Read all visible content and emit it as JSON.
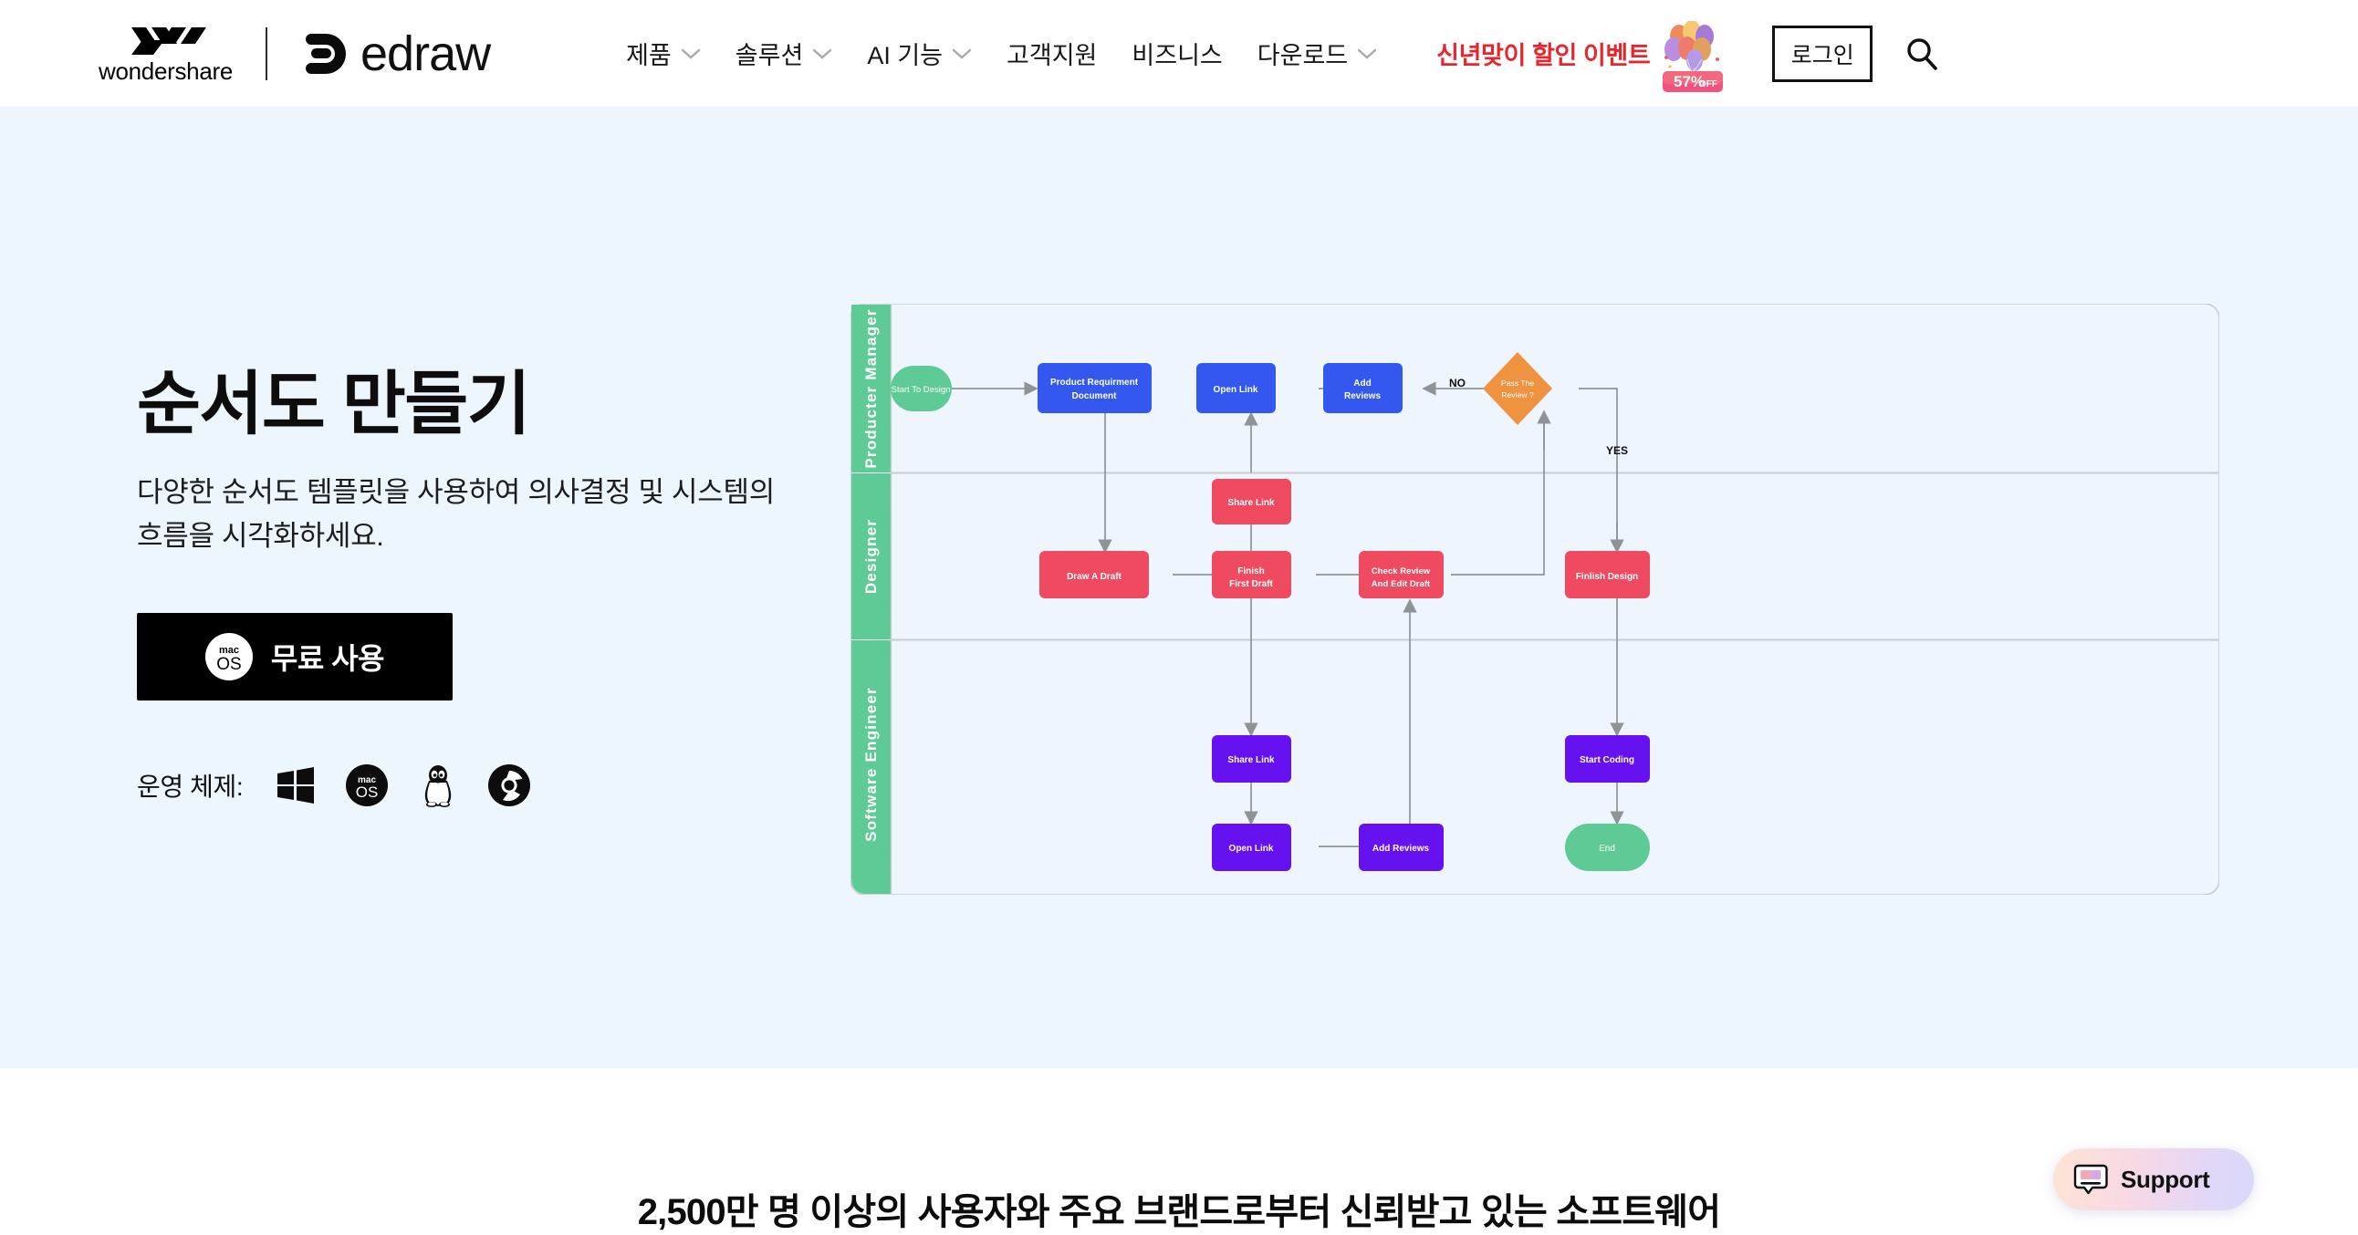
{
  "header": {
    "brand": {
      "wondershare_word": "wondershare",
      "wondershare_icon": "wondershare-w-logo",
      "divider_icon": "brand-divider",
      "edraw_word": "edraw",
      "edraw_icon": "edraw-logo-mark"
    },
    "nav": [
      {
        "label": "제품",
        "has_caret": true,
        "icon": "chevron-down-icon"
      },
      {
        "label": "솔루션",
        "has_caret": true,
        "icon": "chevron-down-icon"
      },
      {
        "label": "AI 기능",
        "has_caret": true,
        "icon": "chevron-down-icon"
      },
      {
        "label": "고객지원",
        "has_caret": false,
        "icon": ""
      },
      {
        "label": "비즈니스",
        "has_caret": false,
        "icon": ""
      },
      {
        "label": "다운로드",
        "has_caret": true,
        "icon": "chevron-down-icon"
      }
    ],
    "promo": {
      "text": "신년맞이 할인 이벤트",
      "badge_icon": "balloons-discount-icon",
      "badge_percent": "57%",
      "badge_off": "OFF",
      "color": "#e8252c"
    },
    "login_label": "로그인",
    "search_icon": "search-icon"
  },
  "hero": {
    "title": "순서도 만들기",
    "subtitle": "다양한 순서도 템플릿을 사용하여 의사결정 및 시스템의 흐름을 시각화하세요.",
    "cta": {
      "label": "무료 사용",
      "icon": "macos-icon"
    },
    "os": {
      "label": "운영 체제:",
      "items": [
        {
          "name": "windows-icon"
        },
        {
          "name": "macos-icon"
        },
        {
          "name": "linux-tux-icon"
        },
        {
          "name": "chrome-os-icon"
        }
      ]
    },
    "background_color": "#edf5fd"
  },
  "chart_data": {
    "type": "diagram",
    "title": "Flowchart swimlane diagram",
    "lane_color": "#5ecb96",
    "canvas_color": "#eef5fd",
    "lanes": [
      {
        "label": "Producter Manager"
      },
      {
        "label": "Designer"
      },
      {
        "label": "Software Engineer"
      }
    ],
    "nodes": [
      {
        "id": "start",
        "label": "Start To Design",
        "lane": 0,
        "shape": "stadium",
        "color": "#5ecb96"
      },
      {
        "id": "prd",
        "label": "Product Requirment Document",
        "lane": 0,
        "shape": "rect",
        "color": "#3357ef"
      },
      {
        "id": "open1",
        "label": "Open Link",
        "lane": 0,
        "shape": "rect",
        "color": "#3357ef"
      },
      {
        "id": "addrev1",
        "label": "Add Reviews",
        "lane": 0,
        "shape": "rect",
        "color": "#3357ef"
      },
      {
        "id": "pass",
        "label": "Pass The Review ?",
        "lane": 0,
        "shape": "diamond",
        "color": "#ef9340"
      },
      {
        "id": "share_d",
        "label": "Share Link",
        "lane": 1,
        "shape": "rect",
        "color": "#ef4a5f"
      },
      {
        "id": "draft",
        "label": "Draw A Draft",
        "lane": 1,
        "shape": "rect",
        "color": "#ef4a5f"
      },
      {
        "id": "finish1st",
        "label": "Finish First Draft",
        "lane": 1,
        "shape": "rect",
        "color": "#ef4a5f"
      },
      {
        "id": "checkrev",
        "label": "Check Review And Edit Draft",
        "lane": 1,
        "shape": "rect",
        "color": "#ef4a5f"
      },
      {
        "id": "finlish",
        "label": "Finlish Design",
        "lane": 1,
        "shape": "rect",
        "color": "#ef4a5f"
      },
      {
        "id": "share_e",
        "label": "Share Link",
        "lane": 2,
        "shape": "rect",
        "color": "#6612f0"
      },
      {
        "id": "open2",
        "label": "Open Link",
        "lane": 2,
        "shape": "rect",
        "color": "#6612f0"
      },
      {
        "id": "addrev2",
        "label": "Add Reviews",
        "lane": 2,
        "shape": "rect",
        "color": "#6612f0"
      },
      {
        "id": "startcode",
        "label": "Start Coding",
        "lane": 2,
        "shape": "rect",
        "color": "#6612f0"
      },
      {
        "id": "end",
        "label": "End",
        "lane": 2,
        "shape": "stadium",
        "color": "#5ecb96"
      }
    ],
    "edge_labels": [
      {
        "id": "no",
        "text": "NO"
      },
      {
        "id": "yes",
        "text": "YES"
      }
    ],
    "edge_color": "#8f9396"
  },
  "below": {
    "title": "2,500만 명 이상의 사용자와 주요 브랜드로부터 신뢰받고 있는 소프트웨어"
  },
  "support": {
    "label": "Support",
    "icon": "support-chat-icon"
  }
}
